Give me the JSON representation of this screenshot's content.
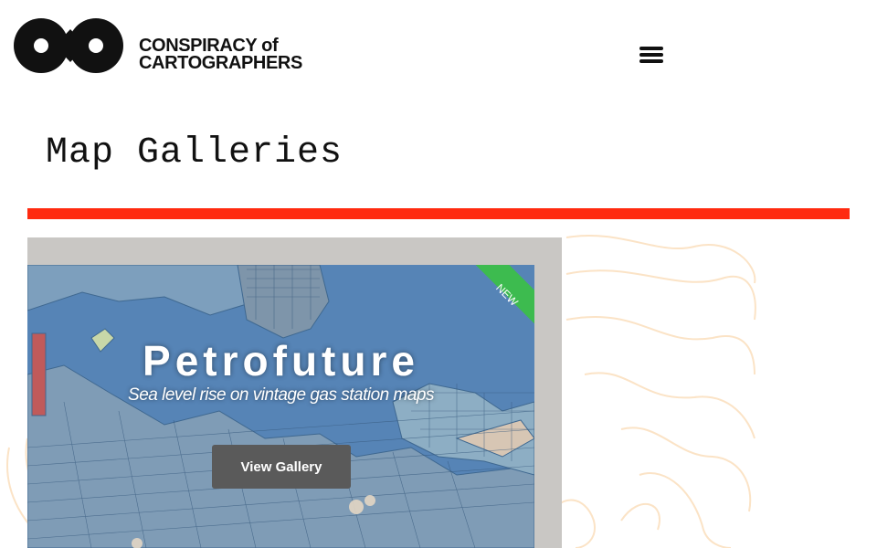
{
  "header": {
    "logo_line1": "CONSPIRACY of",
    "logo_line2": "CARTOGRAPHERS",
    "menu_icon": "hamburger-menu-icon"
  },
  "page": {
    "title": "Map Galleries",
    "accent_color": "#ff2a10"
  },
  "gallery": {
    "title": "Petrofuture",
    "subtitle": "Sea level rise on vintage gas station maps",
    "ribbon_label": "NEW",
    "ribbon_color": "#3dbb4f",
    "button_label": "View Gallery"
  }
}
